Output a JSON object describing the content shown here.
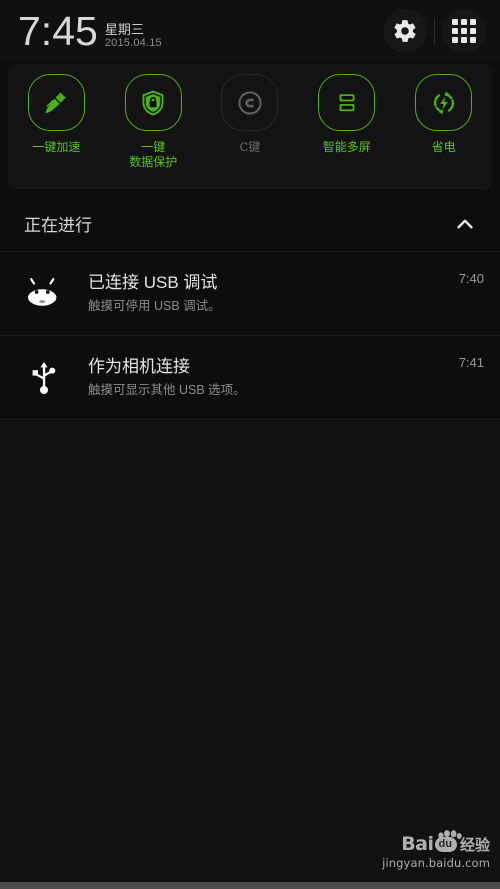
{
  "statusbar": {
    "time": "7:45",
    "weekday": "星期三",
    "date": "2015.04.15",
    "settings_icon": "gear-icon",
    "apps_icon": "grid-apps-icon"
  },
  "quick_settings": {
    "tiles": [
      {
        "label": "一键加速",
        "icon": "broom-icon",
        "enabled": true,
        "color": "#4caf15"
      },
      {
        "label": "一键\n数据保护",
        "icon": "shield-lock-icon",
        "enabled": true,
        "color": "#4caf15"
      },
      {
        "label": "C键",
        "icon": "c-circle-icon",
        "enabled": false,
        "color": "#686868"
      },
      {
        "label": "智能多屏",
        "icon": "split-screen-icon",
        "enabled": true,
        "color": "#4caf15"
      },
      {
        "label": "省电",
        "icon": "power-save-icon",
        "enabled": true,
        "color": "#4caf15"
      }
    ]
  },
  "notifications": {
    "section_title": "正在进行",
    "collapse_icon": "chevron-up-icon",
    "items": [
      {
        "icon": "android-bugdroid-icon",
        "title": "已连接 USB 调试",
        "subtitle": "触摸可停用 USB 调试。",
        "time": "7:40"
      },
      {
        "icon": "usb-icon",
        "title": "作为相机连接",
        "subtitle": "触摸可显示其他 USB 选项。",
        "time": "7:41"
      }
    ]
  },
  "watermark": {
    "brand": "Bai",
    "badge": "du",
    "suffix": "经验",
    "url": "jingyan.baidu.com"
  }
}
